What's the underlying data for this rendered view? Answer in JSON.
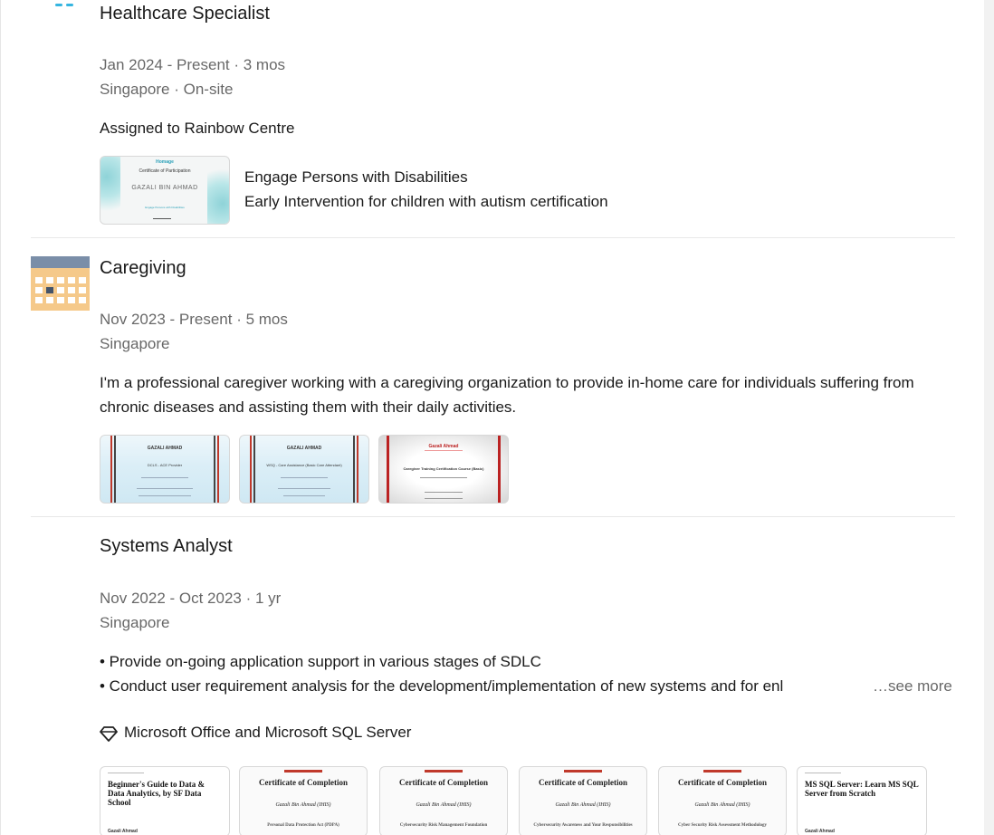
{
  "colors": {
    "accent": "#0a66c2",
    "calendar_top": "#7a8ea8",
    "calendar_body": "#f5c98a"
  },
  "experiences": [
    {
      "title": "Healthcare Specialist",
      "duration": "Jan 2024 - Present · 3 mos",
      "location": "Singapore · On-site",
      "description": "Assigned to Rainbow Centre",
      "media": {
        "title": "Engage Persons with Disabilities",
        "subtitle": "Early Intervention for children with autism certification",
        "cert_heading": "Certificate of Participation",
        "cert_name": "GAZALI BIN AHMAD",
        "cert_course": "Engage Persons with Disabilities",
        "cert_brand": "Homage"
      }
    },
    {
      "title": "Caregiving",
      "duration": "Nov 2023 - Present · 5 mos",
      "location": "Singapore",
      "description": "I'm a professional caregiver working with a caregiving organization to provide in-home care for individuals suffering from chronic diseases and assisting them with their daily activities.",
      "thumbs": [
        {
          "name": "GAZALI AHMAD",
          "course": "DCLS - ACE Provider"
        },
        {
          "name": "GAZALI AHMAD",
          "course": "WSQ - Care Assistance (Basic Care Attendant)"
        },
        {
          "name": "Gazali Ahmad",
          "course": "Caregiver Training Certification Course (Basic)"
        }
      ]
    },
    {
      "title": "Systems Analyst",
      "duration": "Nov 2022 - Oct 2023 · 1 yr",
      "location": "Singapore",
      "bullets": [
        "• Provide on-going application support in various stages of SDLC",
        "• Conduct user requirement analysis for the development/implementation of new systems and for enl"
      ],
      "see_more": "…see more",
      "skills": "Microsoft Office and Microsoft SQL Server",
      "thumbs": [
        {
          "kind": "guide",
          "title": "Beginner's Guide to Data & Data Analytics, by SF Data School",
          "name": "Gazali Ahmad"
        },
        {
          "kind": "complete",
          "title": "Certificate of Completion",
          "name": "Gazali Bin Ahmad (IHIS)",
          "course": "Personal Data Protection Act (PDPA)"
        },
        {
          "kind": "complete",
          "title": "Certificate of Completion",
          "name": "Gazali Bin Ahmad (IHIS)",
          "course": "Cybersecurity Risk Management Foundation"
        },
        {
          "kind": "complete",
          "title": "Certificate of Completion",
          "name": "Gazali Bin Ahmad (IHIS)",
          "course": "Cybersecurity Awareness and Your Responsibilities"
        },
        {
          "kind": "complete",
          "title": "Certificate of Completion",
          "name": "Gazali Bin Ahmad (IHIS)",
          "course": "Cyber Security Risk Assessment Methodology"
        },
        {
          "kind": "guide",
          "title": "MS SQL Server: Learn MS SQL Server from Scratch",
          "name": "Gazali Ahmad"
        }
      ]
    }
  ]
}
